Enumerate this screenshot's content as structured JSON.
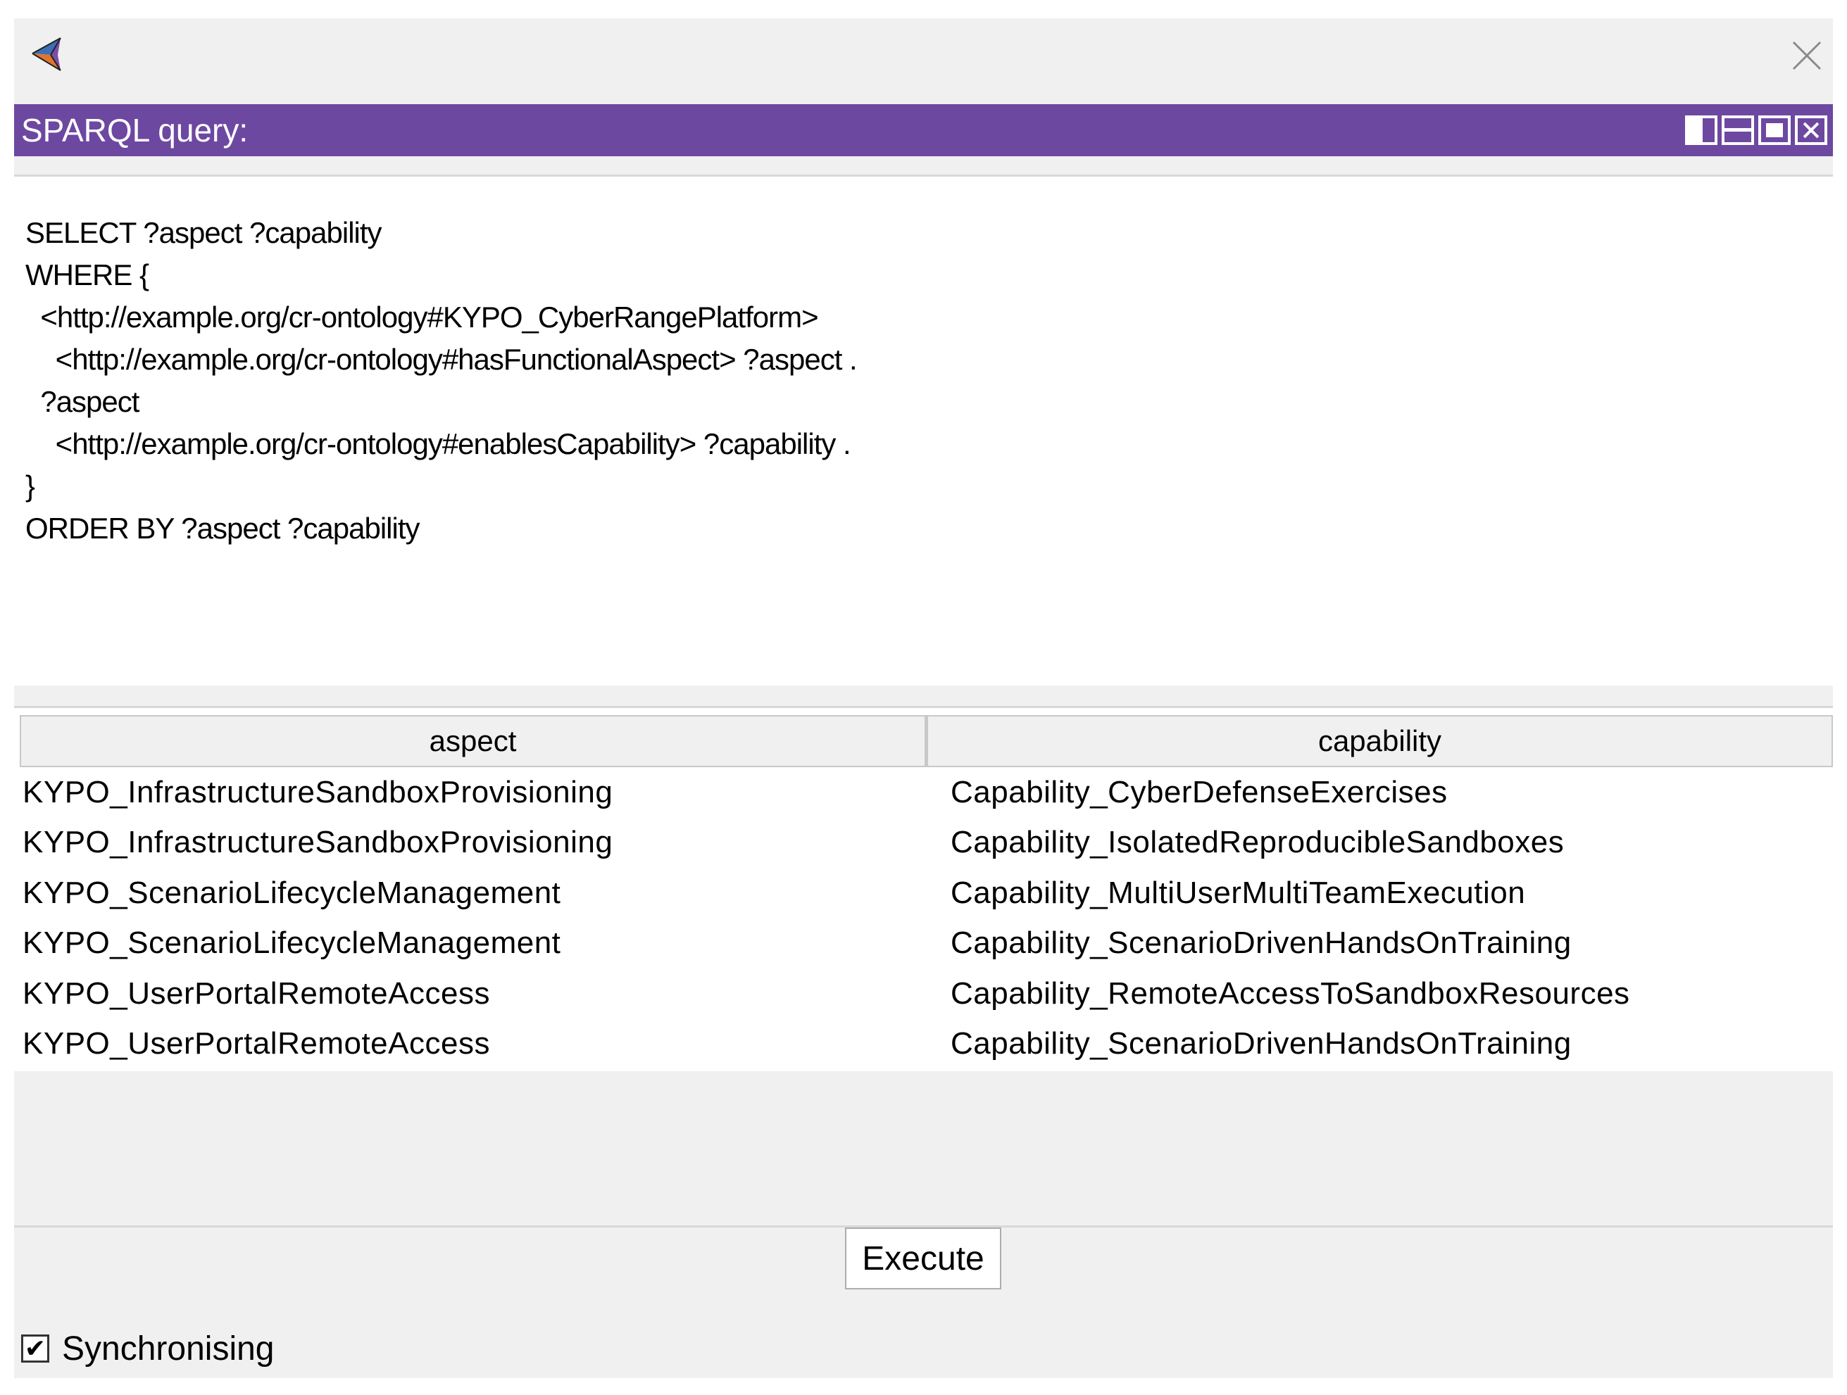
{
  "titlebar": {
    "app_icon": "protege-logo-icon",
    "close_icon": "close-icon"
  },
  "view": {
    "header_label": "SPARQL query:",
    "header_buttons": [
      "split-view-icon",
      "minimize-view-icon",
      "maximize-view-icon",
      "close-view-icon"
    ]
  },
  "query": {
    "text": "SELECT ?aspect ?capability\nWHERE {\n  <http://example.org/cr-ontology#KYPO_CyberRangePlatform>\n    <http://example.org/cr-ontology#hasFunctionalAspect> ?aspect .\n  ?aspect\n    <http://example.org/cr-ontology#enablesCapability> ?capability .\n}\nORDER BY ?aspect ?capability"
  },
  "results": {
    "columns": [
      "aspect",
      "capability"
    ],
    "rows": [
      [
        "KYPO_InfrastructureSandboxProvisioning",
        "Capability_CyberDefenseExercises"
      ],
      [
        "KYPO_InfrastructureSandboxProvisioning",
        "Capability_IsolatedReproducibleSandboxes"
      ],
      [
        "KYPO_ScenarioLifecycleManagement",
        "Capability_MultiUserMultiTeamExecution"
      ],
      [
        "KYPO_ScenarioLifecycleManagement",
        "Capability_ScenarioDrivenHandsOnTraining"
      ],
      [
        "KYPO_UserPortalRemoteAccess",
        "Capability_RemoteAccessToSandboxResources"
      ],
      [
        "KYPO_UserPortalRemoteAccess",
        "Capability_ScenarioDrivenHandsOnTraining"
      ]
    ]
  },
  "footer": {
    "execute_label": "Execute",
    "sync_label": "Synchronising",
    "sync_checked": true,
    "check_glyph": "✔"
  },
  "colors": {
    "header_bg": "#6d48a1",
    "window_bg": "#f0f0f0"
  }
}
